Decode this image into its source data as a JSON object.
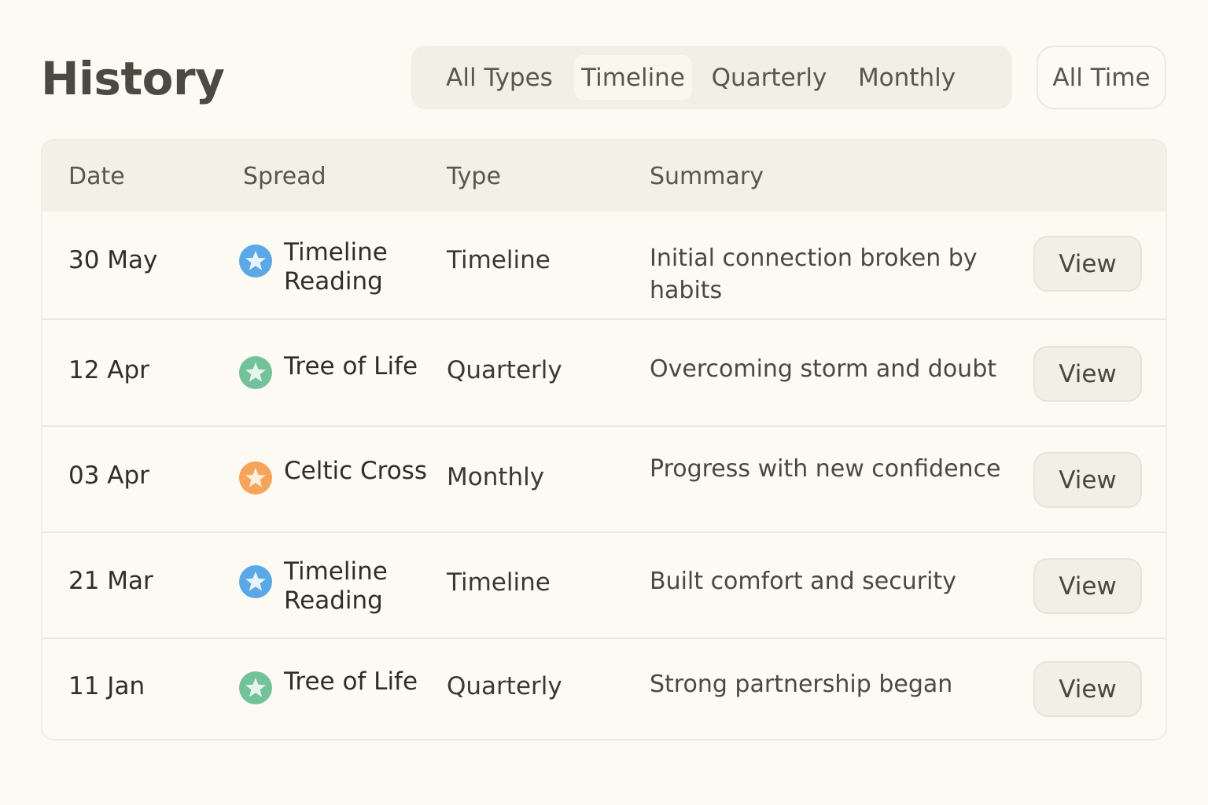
{
  "page": {
    "title": "History"
  },
  "filters": {
    "types": [
      {
        "label": "All Types",
        "active": false
      },
      {
        "label": "Timeline",
        "active": true
      },
      {
        "label": "Quarterly",
        "active": false
      },
      {
        "label": "Monthly",
        "active": false
      }
    ],
    "time_range": "All Time"
  },
  "table": {
    "headers": {
      "date": "Date",
      "spread": "Spread",
      "type": "Type",
      "summary": "Summary"
    },
    "rows": [
      {
        "date": "30 May",
        "spread_line1": "Timeline",
        "spread_line2": "Reading",
        "icon": "blue-star-icon",
        "icon_color": "#5aa9e6",
        "type": "Timeline",
        "summary": "Initial connection broken by habits",
        "action": "View"
      },
      {
        "date": "12 Apr",
        "spread_line1": "Tree of Life",
        "spread_line2": "",
        "icon": "green-star-icon",
        "icon_color": "#74c29a",
        "type": "Quarterly",
        "summary": "Overcoming storm and doubt",
        "action": "View"
      },
      {
        "date": "03 Apr",
        "spread_line1": "Celtic Cross",
        "spread_line2": "",
        "icon": "orange-star-icon",
        "icon_color": "#f5a55a",
        "type": "Monthly",
        "summary": "Progress with new confidence",
        "action": "View"
      },
      {
        "date": "21 Mar",
        "spread_line1": "Timeline",
        "spread_line2": "Reading",
        "icon": "blue-star-icon",
        "icon_color": "#5aa9e6",
        "type": "Timeline",
        "summary": "Built comfort and security",
        "action": "View"
      },
      {
        "date": "11 Jan",
        "spread_line1": "Tree of Life",
        "spread_line2": "",
        "icon": "green-star-icon",
        "icon_color": "#74c29a",
        "type": "Quarterly",
        "summary": "Strong partnership began",
        "action": "View"
      }
    ]
  }
}
